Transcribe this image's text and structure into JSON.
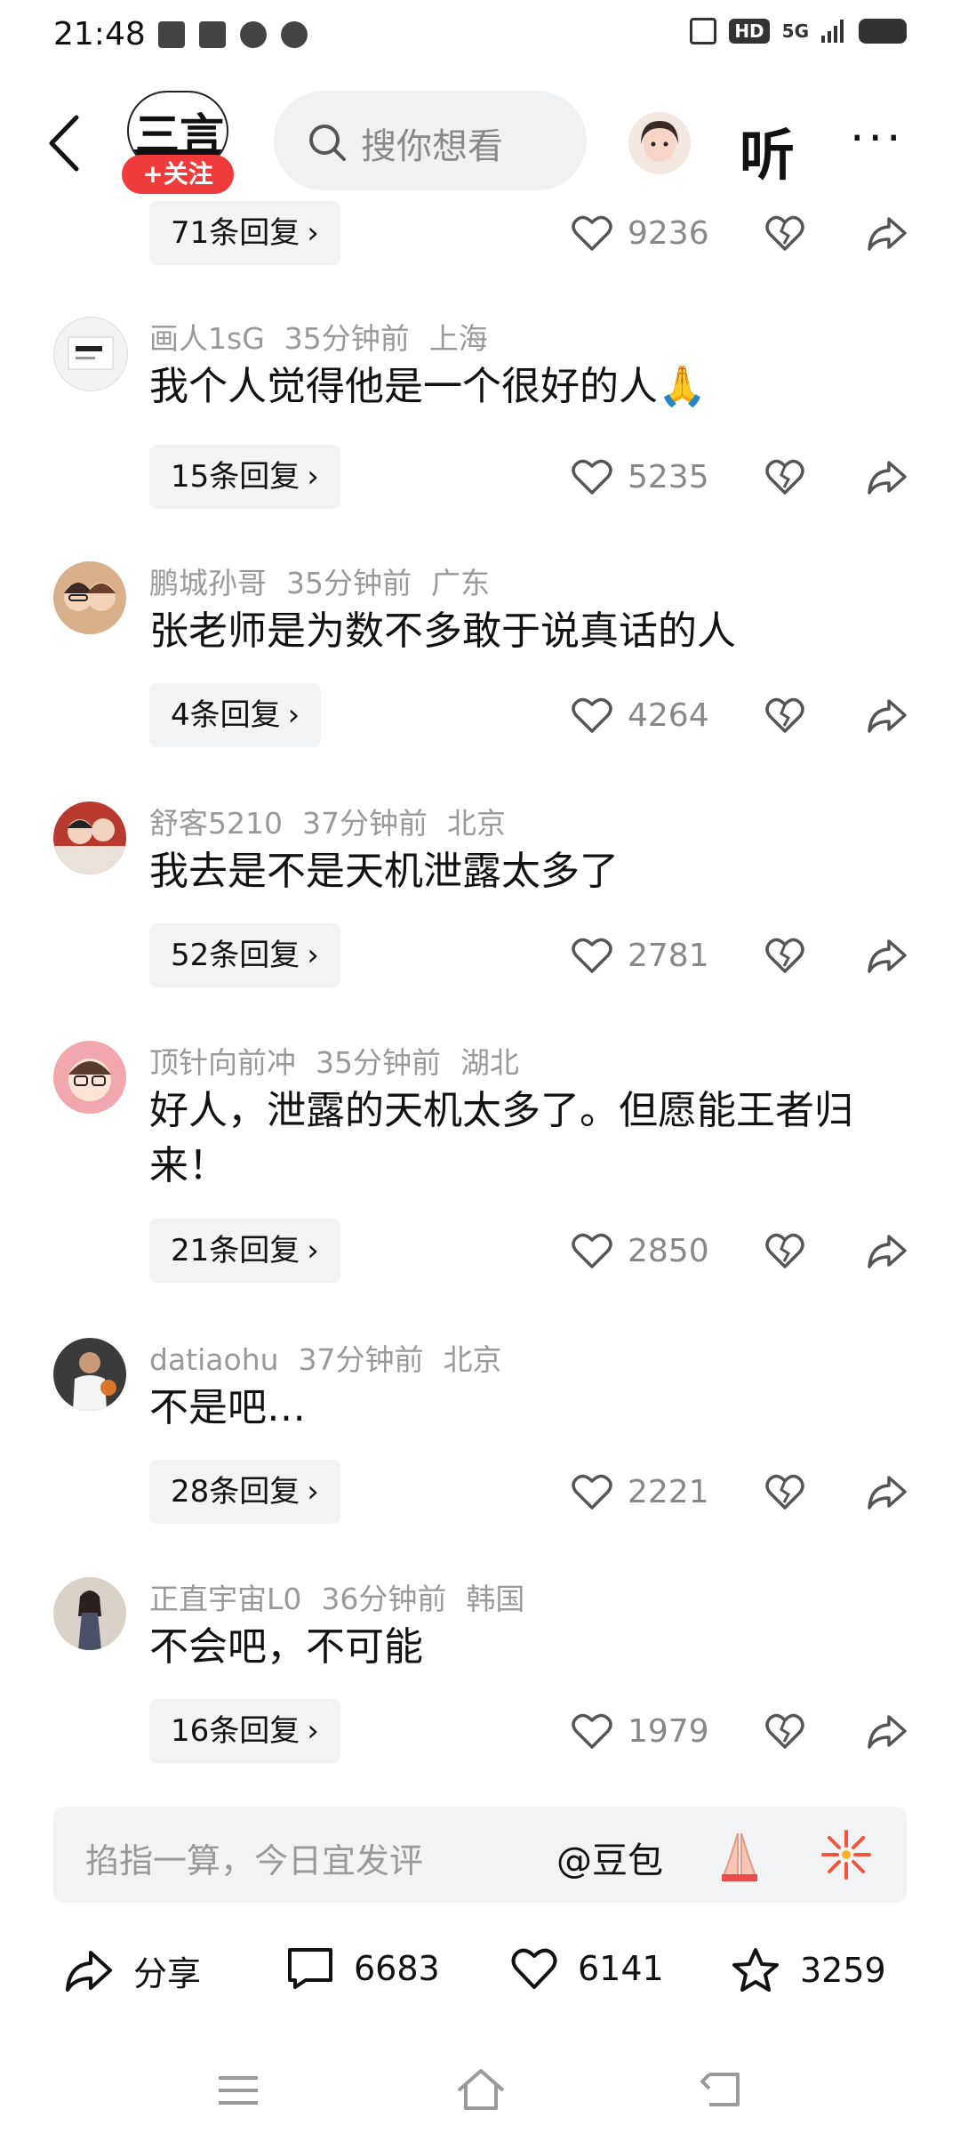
{
  "status_bar": {
    "time": "21:48",
    "hd": "HD",
    "network": "5G",
    "icons": [
      "shield-check-icon",
      "toutiao-icon",
      "baidu-icon",
      "link-icon"
    ]
  },
  "header": {
    "logo_text": "三言",
    "follow_label": "+关注",
    "search_placeholder": "搜你想看",
    "listen_label": "听",
    "more_label": "···"
  },
  "comments": [
    {
      "replies": "71条回复",
      "likes": "9236"
    },
    {
      "user": "画人1sG",
      "time": "35分钟前",
      "location": "上海",
      "text": "我个人觉得他是一个很好的人🙏",
      "replies": "15条回复",
      "likes": "5235"
    },
    {
      "user": "鹏城孙哥",
      "time": "35分钟前",
      "location": "广东",
      "text": "张老师是为数不多敢于说真话的人",
      "replies": "4条回复",
      "likes": "4264"
    },
    {
      "user": "舒客5210",
      "time": "37分钟前",
      "location": "北京",
      "text": "我去是不是天机泄露太多了",
      "replies": "52条回复",
      "likes": "2781"
    },
    {
      "user": "顶针向前冲",
      "time": "35分钟前",
      "location": "湖北",
      "text": "好人，泄露的天机太多了。但愿能王者归来！",
      "replies": "21条回复",
      "likes": "2850"
    },
    {
      "user": "datiaohu",
      "time": "37分钟前",
      "location": "北京",
      "text": "不是吧…",
      "replies": "28条回复",
      "likes": "2221"
    },
    {
      "user": "正直宇宙L0",
      "time": "36分钟前",
      "location": "韩国",
      "text": "不会吧，不可能",
      "replies": "16条回复",
      "likes": "1979"
    }
  ],
  "input_bar": {
    "placeholder": "掐指一算，今日宜发评",
    "mention": "@豆包"
  },
  "actions": {
    "share": "分享",
    "comments": "6683",
    "likes": "6141",
    "favorites": "3259"
  },
  "colors": {
    "accent_red": "#ef3b3b",
    "meta_gray": "#999999",
    "chip_bg": "#f2f3f5"
  }
}
